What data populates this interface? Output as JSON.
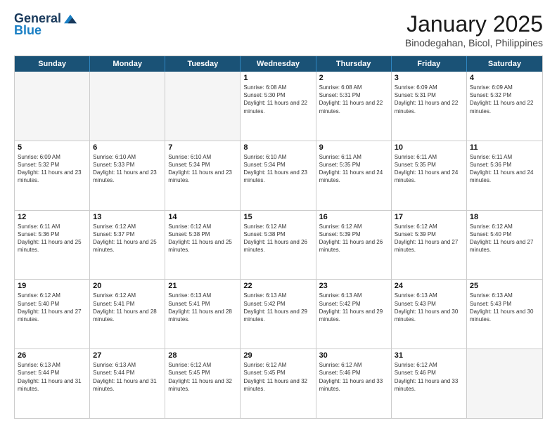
{
  "logo": {
    "general": "General",
    "blue": "Blue"
  },
  "header": {
    "month": "January 2025",
    "location": "Binodegahan, Bicol, Philippines"
  },
  "weekdays": [
    "Sunday",
    "Monday",
    "Tuesday",
    "Wednesday",
    "Thursday",
    "Friday",
    "Saturday"
  ],
  "rows": [
    [
      {
        "day": "",
        "empty": true
      },
      {
        "day": "",
        "empty": true
      },
      {
        "day": "",
        "empty": true
      },
      {
        "day": "1",
        "sunrise": "6:08 AM",
        "sunset": "5:30 PM",
        "daylight": "11 hours and 22 minutes."
      },
      {
        "day": "2",
        "sunrise": "6:08 AM",
        "sunset": "5:31 PM",
        "daylight": "11 hours and 22 minutes."
      },
      {
        "day": "3",
        "sunrise": "6:09 AM",
        "sunset": "5:31 PM",
        "daylight": "11 hours and 22 minutes."
      },
      {
        "day": "4",
        "sunrise": "6:09 AM",
        "sunset": "5:32 PM",
        "daylight": "11 hours and 22 minutes."
      }
    ],
    [
      {
        "day": "5",
        "sunrise": "6:09 AM",
        "sunset": "5:32 PM",
        "daylight": "11 hours and 23 minutes."
      },
      {
        "day": "6",
        "sunrise": "6:10 AM",
        "sunset": "5:33 PM",
        "daylight": "11 hours and 23 minutes."
      },
      {
        "day": "7",
        "sunrise": "6:10 AM",
        "sunset": "5:34 PM",
        "daylight": "11 hours and 23 minutes."
      },
      {
        "day": "8",
        "sunrise": "6:10 AM",
        "sunset": "5:34 PM",
        "daylight": "11 hours and 23 minutes."
      },
      {
        "day": "9",
        "sunrise": "6:11 AM",
        "sunset": "5:35 PM",
        "daylight": "11 hours and 24 minutes."
      },
      {
        "day": "10",
        "sunrise": "6:11 AM",
        "sunset": "5:35 PM",
        "daylight": "11 hours and 24 minutes."
      },
      {
        "day": "11",
        "sunrise": "6:11 AM",
        "sunset": "5:36 PM",
        "daylight": "11 hours and 24 minutes."
      }
    ],
    [
      {
        "day": "12",
        "sunrise": "6:11 AM",
        "sunset": "5:36 PM",
        "daylight": "11 hours and 25 minutes."
      },
      {
        "day": "13",
        "sunrise": "6:12 AM",
        "sunset": "5:37 PM",
        "daylight": "11 hours and 25 minutes."
      },
      {
        "day": "14",
        "sunrise": "6:12 AM",
        "sunset": "5:38 PM",
        "daylight": "11 hours and 25 minutes."
      },
      {
        "day": "15",
        "sunrise": "6:12 AM",
        "sunset": "5:38 PM",
        "daylight": "11 hours and 26 minutes."
      },
      {
        "day": "16",
        "sunrise": "6:12 AM",
        "sunset": "5:39 PM",
        "daylight": "11 hours and 26 minutes."
      },
      {
        "day": "17",
        "sunrise": "6:12 AM",
        "sunset": "5:39 PM",
        "daylight": "11 hours and 27 minutes."
      },
      {
        "day": "18",
        "sunrise": "6:12 AM",
        "sunset": "5:40 PM",
        "daylight": "11 hours and 27 minutes."
      }
    ],
    [
      {
        "day": "19",
        "sunrise": "6:12 AM",
        "sunset": "5:40 PM",
        "daylight": "11 hours and 27 minutes."
      },
      {
        "day": "20",
        "sunrise": "6:12 AM",
        "sunset": "5:41 PM",
        "daylight": "11 hours and 28 minutes."
      },
      {
        "day": "21",
        "sunrise": "6:13 AM",
        "sunset": "5:41 PM",
        "daylight": "11 hours and 28 minutes."
      },
      {
        "day": "22",
        "sunrise": "6:13 AM",
        "sunset": "5:42 PM",
        "daylight": "11 hours and 29 minutes."
      },
      {
        "day": "23",
        "sunrise": "6:13 AM",
        "sunset": "5:42 PM",
        "daylight": "11 hours and 29 minutes."
      },
      {
        "day": "24",
        "sunrise": "6:13 AM",
        "sunset": "5:43 PM",
        "daylight": "11 hours and 30 minutes."
      },
      {
        "day": "25",
        "sunrise": "6:13 AM",
        "sunset": "5:43 PM",
        "daylight": "11 hours and 30 minutes."
      }
    ],
    [
      {
        "day": "26",
        "sunrise": "6:13 AM",
        "sunset": "5:44 PM",
        "daylight": "11 hours and 31 minutes."
      },
      {
        "day": "27",
        "sunrise": "6:13 AM",
        "sunset": "5:44 PM",
        "daylight": "11 hours and 31 minutes."
      },
      {
        "day": "28",
        "sunrise": "6:12 AM",
        "sunset": "5:45 PM",
        "daylight": "11 hours and 32 minutes."
      },
      {
        "day": "29",
        "sunrise": "6:12 AM",
        "sunset": "5:45 PM",
        "daylight": "11 hours and 32 minutes."
      },
      {
        "day": "30",
        "sunrise": "6:12 AM",
        "sunset": "5:46 PM",
        "daylight": "11 hours and 33 minutes."
      },
      {
        "day": "31",
        "sunrise": "6:12 AM",
        "sunset": "5:46 PM",
        "daylight": "11 hours and 33 minutes."
      },
      {
        "day": "",
        "empty": true
      }
    ]
  ]
}
